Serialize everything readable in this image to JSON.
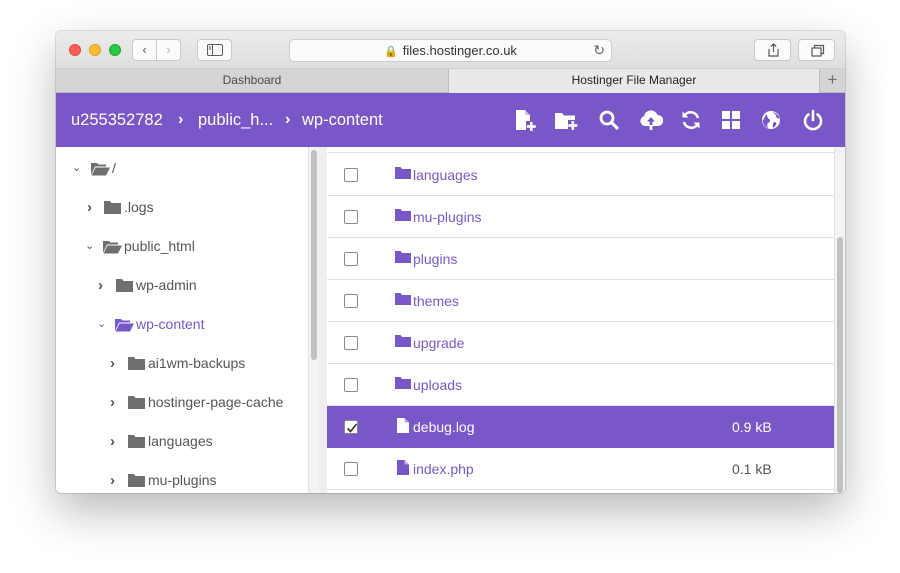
{
  "browser": {
    "url": "files.hostinger.co.uk",
    "nav_back": "‹",
    "nav_forward": "›",
    "reload": "↻",
    "lock": "🔒",
    "tabs": [
      {
        "label": "Dashboard"
      },
      {
        "label": "Hostinger File Manager"
      }
    ],
    "new_tab": "+"
  },
  "header": {
    "breadcrumbs": [
      "u255352782",
      "public_h...",
      "wp-content"
    ],
    "separator": "›",
    "icons": [
      "new-file-icon",
      "new-folder-icon",
      "search-icon",
      "upload-icon",
      "refresh-icon",
      "grid-view-icon",
      "globe-icon",
      "power-icon"
    ]
  },
  "tree": {
    "items": [
      {
        "label": "/",
        "arrow": "⌄"
      },
      {
        "label": ".logs",
        "arrow": "›"
      },
      {
        "label": "public_html",
        "arrow": "⌄"
      },
      {
        "label": "wp-admin",
        "arrow": "›"
      },
      {
        "label": "wp-content",
        "arrow": "⌄"
      },
      {
        "label": "ai1wm-backups",
        "arrow": "›"
      },
      {
        "label": "hostinger-page-cache",
        "arrow": "›"
      },
      {
        "label": "languages",
        "arrow": "›"
      },
      {
        "label": "mu-plugins",
        "arrow": "›"
      }
    ]
  },
  "files": [
    {
      "name": "languages",
      "type": "folder",
      "size": ""
    },
    {
      "name": "mu-plugins",
      "type": "folder",
      "size": ""
    },
    {
      "name": "plugins",
      "type": "folder",
      "size": ""
    },
    {
      "name": "themes",
      "type": "folder",
      "size": ""
    },
    {
      "name": "upgrade",
      "type": "folder",
      "size": ""
    },
    {
      "name": "uploads",
      "type": "folder",
      "size": ""
    },
    {
      "name": "debug.log",
      "type": "file",
      "size": "0.9 kB",
      "selected": true
    },
    {
      "name": "index.php",
      "type": "file",
      "size": "0.1 kB"
    }
  ],
  "colors": {
    "accent": "#7957c9",
    "folder_grey": "#6f6f6f"
  }
}
